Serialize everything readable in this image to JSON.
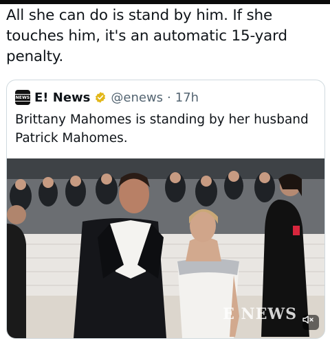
{
  "post": {
    "text": "All she can do is stand by him. If she touches him, it's an automatic 15-yard penalty."
  },
  "quoted_post": {
    "avatar_text": "NEWS",
    "display_name": "E! News",
    "handle": "@enews",
    "separator": "·",
    "timestamp": "17h",
    "text": "Brittany Mahomes is standing by her husband Patrick Mahomes.",
    "media": {
      "watermark": "E NEWS",
      "mute_icon": "volume-mute-icon"
    }
  },
  "colors": {
    "verified_badge": "#e2b719",
    "secondary_text": "#536471",
    "border": "#cfd9de"
  }
}
